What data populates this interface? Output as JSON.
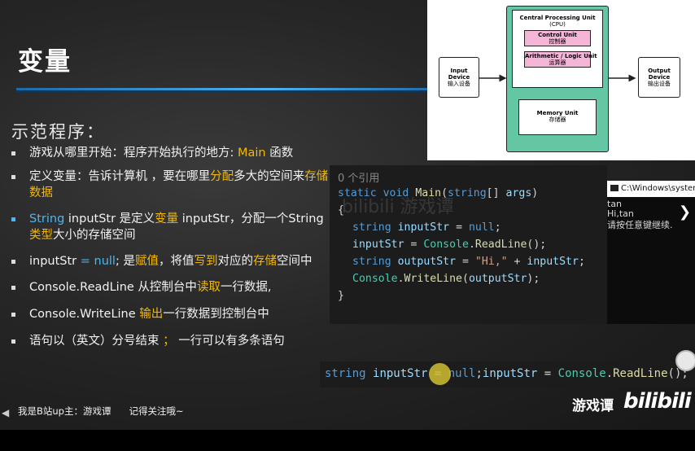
{
  "slide": {
    "title": "变量",
    "subtitle": "示范程序：",
    "bullets": {
      "b1": {
        "text": "游戏从哪里开始：程序开始执行的地方: ",
        "hl": "Main",
        "tail": " 函数"
      },
      "b2": {
        "a": "定义变量：告诉计算机 ，要在哪里",
        "hl1": "分配",
        "b": "多大的空间来",
        "hl2": "存储数据"
      },
      "b3": {
        "blue": "String",
        "a": " inputStr  是定义",
        "hl1": "变量",
        "b": " inputStr，分配一个String",
        "hl2": "类型",
        "c": "大小的存储空间"
      },
      "b4": {
        "a": "inputStr ",
        "blue": "= null",
        "b": "; 是",
        "hl1": "赋值",
        "c": "，将值",
        "hl2": "写到",
        "d": "对应的",
        "hl3": "存储",
        "e": "空间中"
      },
      "b5": {
        "a": "Console.ReadLine 从控制台中",
        "hl": "读取",
        "b": "一行数据,"
      },
      "b6": {
        "a": "Console.WriteLine ",
        "hl": "输出",
        "b": "一行数据到控制台中"
      },
      "b7": {
        "a": "语句以（英文）分号结束 ",
        "hl": "；",
        "b": " 一行可以有多条语句"
      }
    },
    "footer": {
      "uploader": "我是B站up主：游戏谭",
      "follow": "记得关注哦~"
    }
  },
  "diagram": {
    "cpu_title": "Central Processing Unit",
    "cpu_sub": "(CPU)",
    "control_en": "Control Unit",
    "control_cn": "控制器",
    "alu_en": "Arithmetic / Logic Unit",
    "alu_cn": "运算器",
    "memory_en": "Memory Unit",
    "memory_cn": "存储器",
    "input_en1": "Input",
    "input_en2": "Device",
    "input_cn": "输入设备",
    "output_en1": "Output",
    "output_en2": "Device",
    "output_cn": "输出设备",
    "colors": {
      "cpu_fill": "#62c7a2",
      "unit_fill": "#f5b5d7"
    }
  },
  "code": {
    "refs": "0 个引用",
    "l1": {
      "kw1": "static",
      "kw2": "void",
      "fn": "Main",
      "p1": "(",
      "ty": "string",
      "p2": "[] ",
      "arg": "args",
      "p3": ")"
    },
    "brace_open": "{",
    "l3": {
      "ty": "string",
      "var": "inputStr",
      "op": " = ",
      "val": "null",
      "end": ";"
    },
    "l4": {
      "var": "inputStr",
      "op": " = ",
      "cls": "Console",
      "dot": ".",
      "fn": "ReadLine",
      "end": "();"
    },
    "l5": {
      "ty": "string",
      "var": "outputStr",
      "op": " = ",
      "str": "\"Hi,\"",
      "plus": " + ",
      "var2": "inputStr",
      "end": ";"
    },
    "l6": {
      "cls": "Console",
      "dot": ".",
      "fn": "WriteLine",
      "p1": "(",
      "var": "outputStr",
      "end": ");"
    },
    "brace_close": "}"
  },
  "console": {
    "title": "C:\\Windows\\syster",
    "line1": "tan",
    "line2": "Hi,tan",
    "line3": "请按任意键继续."
  },
  "code_line2": {
    "ty": "string",
    "var": "inputStr",
    "op1": " = ",
    "val": "null",
    "sep": ";",
    "var2": "inputStr",
    "op2": " = ",
    "cls": "Console",
    "dot": ".",
    "fn": "ReadLine",
    "end": "();"
  },
  "watermark": "bilibili  游戏谭",
  "brand": {
    "name": "游戏谭",
    "site": "bilibili"
  }
}
